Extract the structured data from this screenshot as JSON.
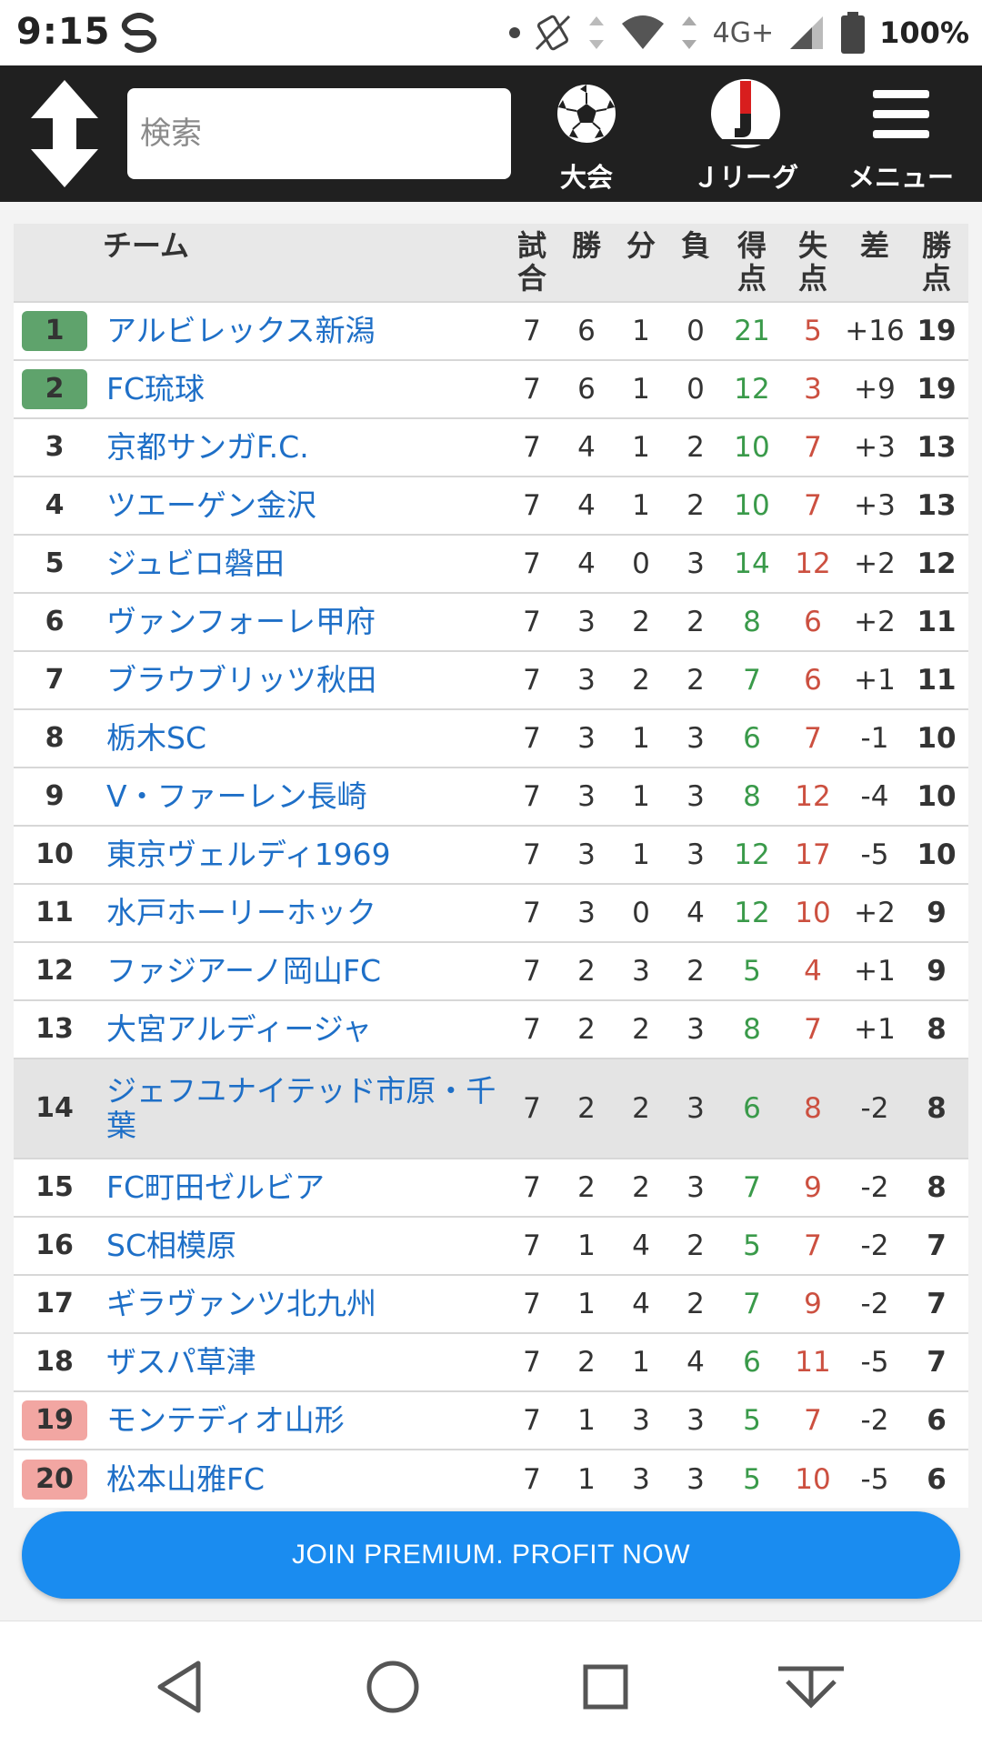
{
  "status_bar": {
    "time": "9:15",
    "network": "4G+",
    "battery": "100%"
  },
  "header": {
    "search_placeholder": "検索",
    "nav": [
      {
        "label": "大会",
        "icon": "soccer-ball-icon"
      },
      {
        "label": "Ｊリーグ",
        "icon": "jleague-logo-icon"
      },
      {
        "label": "メニュー",
        "icon": "hamburger-menu-icon"
      }
    ]
  },
  "table": {
    "headers": {
      "team": "チーム",
      "played_1": "試",
      "played_2": "合",
      "win": "勝",
      "draw": "分",
      "loss": "負",
      "gf_1": "得",
      "gf_2": "点",
      "ga_1": "失",
      "ga_2": "点",
      "diff": "差",
      "pts_1": "勝",
      "pts_2": "点"
    },
    "rows": [
      {
        "rank": "1",
        "team": "アルビレックス新潟",
        "p": "7",
        "w": "6",
        "d": "1",
        "l": "0",
        "gf": "21",
        "ga": "5",
        "gd": "+16",
        "pts": "19",
        "zone": "promo"
      },
      {
        "rank": "2",
        "team": "FC琉球",
        "p": "7",
        "w": "6",
        "d": "1",
        "l": "0",
        "gf": "12",
        "ga": "3",
        "gd": "+9",
        "pts": "19",
        "zone": "promo"
      },
      {
        "rank": "3",
        "team": "京都サンガF.C.",
        "p": "7",
        "w": "4",
        "d": "1",
        "l": "2",
        "gf": "10",
        "ga": "7",
        "gd": "+3",
        "pts": "13",
        "zone": ""
      },
      {
        "rank": "4",
        "team": "ツエーゲン金沢",
        "p": "7",
        "w": "4",
        "d": "1",
        "l": "2",
        "gf": "10",
        "ga": "7",
        "gd": "+3",
        "pts": "13",
        "zone": ""
      },
      {
        "rank": "5",
        "team": "ジュビロ磐田",
        "p": "7",
        "w": "4",
        "d": "0",
        "l": "3",
        "gf": "14",
        "ga": "12",
        "gd": "+2",
        "pts": "12",
        "zone": ""
      },
      {
        "rank": "6",
        "team": "ヴァンフォーレ甲府",
        "p": "7",
        "w": "3",
        "d": "2",
        "l": "2",
        "gf": "8",
        "ga": "6",
        "gd": "+2",
        "pts": "11",
        "zone": ""
      },
      {
        "rank": "7",
        "team": "ブラウブリッツ秋田",
        "p": "7",
        "w": "3",
        "d": "2",
        "l": "2",
        "gf": "7",
        "ga": "6",
        "gd": "+1",
        "pts": "11",
        "zone": ""
      },
      {
        "rank": "8",
        "team": "栃木SC",
        "p": "7",
        "w": "3",
        "d": "1",
        "l": "3",
        "gf": "6",
        "ga": "7",
        "gd": "-1",
        "pts": "10",
        "zone": ""
      },
      {
        "rank": "9",
        "team": "V・ファーレン長崎",
        "p": "7",
        "w": "3",
        "d": "1",
        "l": "3",
        "gf": "8",
        "ga": "12",
        "gd": "-4",
        "pts": "10",
        "zone": ""
      },
      {
        "rank": "10",
        "team": "東京ヴェルディ1969",
        "p": "7",
        "w": "3",
        "d": "1",
        "l": "3",
        "gf": "12",
        "ga": "17",
        "gd": "-5",
        "pts": "10",
        "zone": ""
      },
      {
        "rank": "11",
        "team": "水戸ホーリーホック",
        "p": "7",
        "w": "3",
        "d": "0",
        "l": "4",
        "gf": "12",
        "ga": "10",
        "gd": "+2",
        "pts": "9",
        "zone": ""
      },
      {
        "rank": "12",
        "team": "ファジアーノ岡山FC",
        "p": "7",
        "w": "2",
        "d": "3",
        "l": "2",
        "gf": "5",
        "ga": "4",
        "gd": "+1",
        "pts": "9",
        "zone": ""
      },
      {
        "rank": "13",
        "team": "大宮アルディージャ",
        "p": "7",
        "w": "2",
        "d": "2",
        "l": "3",
        "gf": "8",
        "ga": "7",
        "gd": "+1",
        "pts": "8",
        "zone": ""
      },
      {
        "rank": "14",
        "team": "ジェフユナイテッド市原・千葉",
        "p": "7",
        "w": "2",
        "d": "2",
        "l": "3",
        "gf": "6",
        "ga": "8",
        "gd": "-2",
        "pts": "8",
        "zone": "",
        "highlight": true
      },
      {
        "rank": "15",
        "team": "FC町田ゼルビア",
        "p": "7",
        "w": "2",
        "d": "2",
        "l": "3",
        "gf": "7",
        "ga": "9",
        "gd": "-2",
        "pts": "8",
        "zone": ""
      },
      {
        "rank": "16",
        "team": "SC相模原",
        "p": "7",
        "w": "1",
        "d": "4",
        "l": "2",
        "gf": "5",
        "ga": "7",
        "gd": "-2",
        "pts": "7",
        "zone": ""
      },
      {
        "rank": "17",
        "team": "ギラヴァンツ北九州",
        "p": "7",
        "w": "1",
        "d": "4",
        "l": "2",
        "gf": "7",
        "ga": "9",
        "gd": "-2",
        "pts": "7",
        "zone": ""
      },
      {
        "rank": "18",
        "team": "ザスパ草津",
        "p": "7",
        "w": "2",
        "d": "1",
        "l": "4",
        "gf": "6",
        "ga": "11",
        "gd": "-5",
        "pts": "7",
        "zone": ""
      },
      {
        "rank": "19",
        "team": "モンテディオ山形",
        "p": "7",
        "w": "1",
        "d": "3",
        "l": "3",
        "gf": "5",
        "ga": "7",
        "gd": "-2",
        "pts": "6",
        "zone": "releg"
      },
      {
        "rank": "20",
        "team": "松本山雅FC",
        "p": "7",
        "w": "1",
        "d": "3",
        "l": "3",
        "gf": "5",
        "ga": "10",
        "gd": "-5",
        "pts": "6",
        "zone": "releg"
      }
    ]
  },
  "cta": {
    "label": "JOIN PREMIUM. PROFIT NOW"
  },
  "colors": {
    "header_bg": "#202020",
    "link": "#1e6fc7",
    "goals_for": "#3a9a4a",
    "goals_against": "#cc5040",
    "promo_badge": "#5fa36c",
    "releg_badge": "#f2a6a2",
    "cta_bg": "#1a8cf0"
  }
}
